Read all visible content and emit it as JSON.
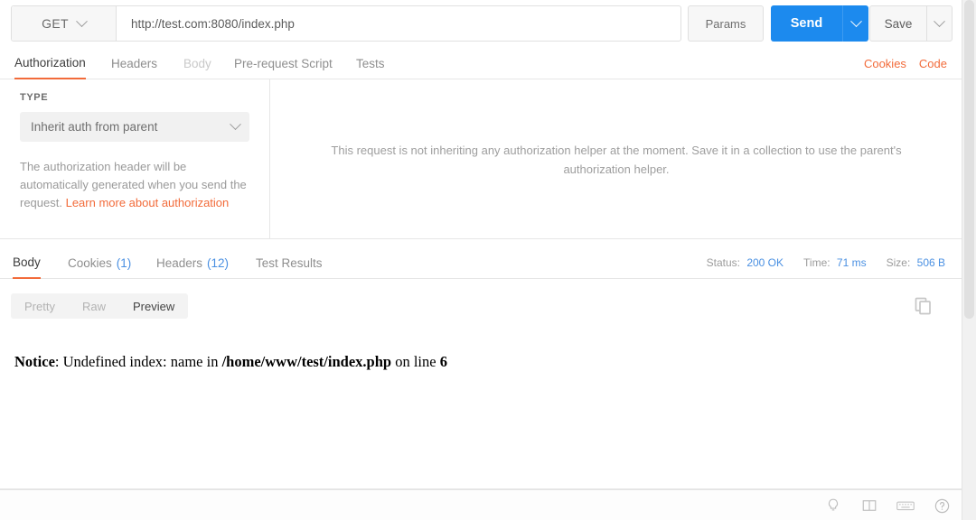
{
  "request_bar": {
    "method": "GET",
    "method_caret_icon": "chevron-down-icon",
    "url": "http://test.com:8080/index.php",
    "url_placeholder": "Enter request URL",
    "params_label": "Params",
    "send_label": "Send",
    "send_caret_icon": "chevron-down-icon",
    "save_label": "Save",
    "save_caret_icon": "chevron-down-icon",
    "send_button_color": "#1c8aee"
  },
  "request_tabs": {
    "items": [
      {
        "label": "Authorization",
        "state": "active"
      },
      {
        "label": "Headers",
        "state": "normal"
      },
      {
        "label": "Body",
        "state": "disabled"
      },
      {
        "label": "Pre-request Script",
        "state": "normal"
      },
      {
        "label": "Tests",
        "state": "normal"
      }
    ],
    "active_color": "#f26b3a",
    "links": [
      {
        "label": "Cookies"
      },
      {
        "label": "Code"
      }
    ]
  },
  "authorization": {
    "type_label": "TYPE",
    "type_value": "Inherit auth from parent",
    "type_caret_icon": "chevron-down-icon",
    "help_text": "The authorization header will be automatically generated when you send the request. ",
    "help_link": "Learn more about authorization",
    "info_message": "This request is not inheriting any authorization helper at the moment. Save it in a collection to use the parent's authorization helper."
  },
  "response_tabs": {
    "items": [
      {
        "label": "Body",
        "count": "",
        "state": "active"
      },
      {
        "label": "Cookies",
        "count": "(1)",
        "state": "normal"
      },
      {
        "label": "Headers",
        "count": "(12)",
        "state": "normal"
      },
      {
        "label": "Test Results",
        "count": "",
        "state": "normal"
      }
    ],
    "meta": [
      {
        "key": "Status:",
        "value": "200 OK"
      },
      {
        "key": "Time:",
        "value": "71 ms"
      },
      {
        "key": "Size:",
        "value": "506 B"
      }
    ],
    "meta_value_color": "#4a90e2"
  },
  "format_toggle": {
    "items": [
      {
        "label": "Pretty",
        "state": "normal"
      },
      {
        "label": "Raw",
        "state": "normal"
      },
      {
        "label": "Preview",
        "state": "active"
      }
    ],
    "copy_icon": "copy-icon"
  },
  "preview": {
    "notice_label": "Notice",
    "notice_mid": ": Undefined index: name in ",
    "notice_path": "/home/www/test/index.php",
    "notice_tail": " on line ",
    "notice_line_no": "6"
  },
  "bottom_bar": {
    "icons": [
      {
        "name": "lightbulb-icon"
      },
      {
        "name": "two-pane-layout-icon"
      },
      {
        "name": "keyboard-icon"
      },
      {
        "name": "help-circle-icon"
      }
    ]
  }
}
